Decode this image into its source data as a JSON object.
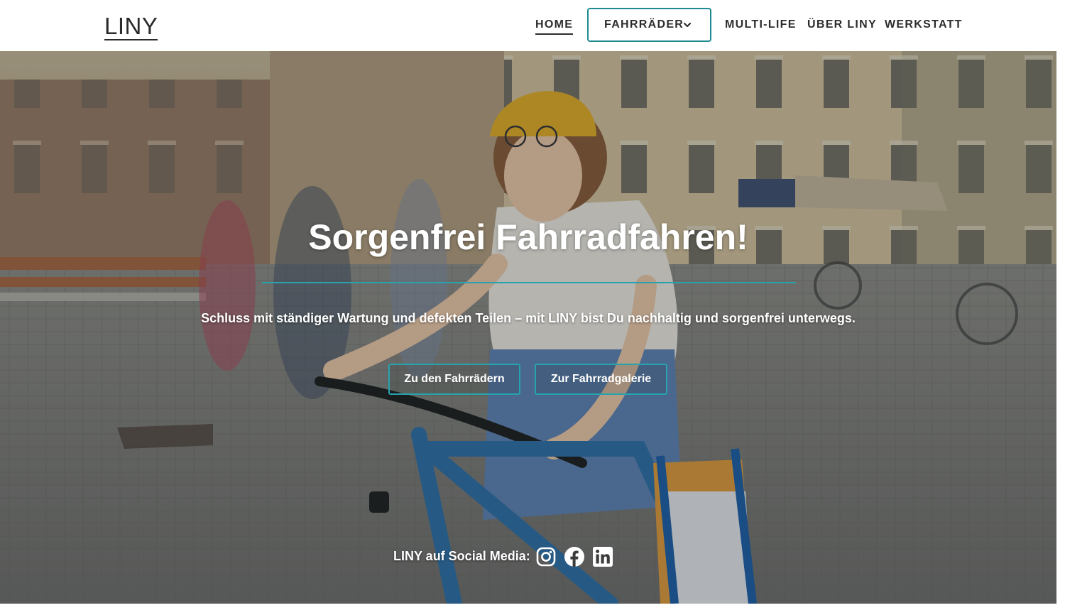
{
  "brand": {
    "logo_text": "LINY"
  },
  "nav": {
    "home": "HOME",
    "fahrraeder": "FAHRRÄDER",
    "multi_life": "MULTI-LIFE",
    "ueber_liny": "ÜBER LINY",
    "werkstatt": "WERKSTATT",
    "active": "HOME",
    "dropdown_icon": "chevron-down-icon"
  },
  "hero": {
    "title": "Sorgenfrei Fahrradfahren!",
    "subtitle": "Schluss mit ständiger Wartung und defekten Teilen – mit LINY bist Du nachhaltig und sorgenfrei unterwegs.",
    "primary_button": "Zu den Fahrrädern",
    "secondary_button": "Zur Fahrradgalerie",
    "background_image": "woman-riding-blue-bicycle-in-town-square"
  },
  "social": {
    "label": "LINY auf Social Media:",
    "icons": [
      "instagram-icon",
      "facebook-icon",
      "linkedin-icon"
    ]
  },
  "colors": {
    "accent": "#27a3ad",
    "nav_text": "#2d2d2d",
    "hero_text": "#ffffff"
  }
}
